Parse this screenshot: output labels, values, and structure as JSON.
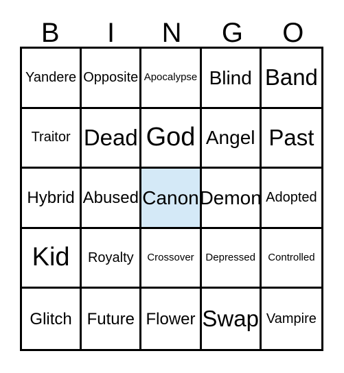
{
  "card": {
    "header": {
      "letters": [
        "B",
        "I",
        "N",
        "G",
        "O"
      ]
    },
    "marked_color": "#d4e9f7",
    "border_color": "#000000",
    "background_color": "#ffffff",
    "rows": [
      [
        {
          "label": "Yandere",
          "marked": false
        },
        {
          "label": "Opposite",
          "marked": false
        },
        {
          "label": "Apocalypse",
          "marked": false
        },
        {
          "label": "Blind",
          "marked": false
        },
        {
          "label": "Band",
          "marked": false
        }
      ],
      [
        {
          "label": "Traitor",
          "marked": false
        },
        {
          "label": "Dead",
          "marked": false
        },
        {
          "label": "God",
          "marked": false
        },
        {
          "label": "Angel",
          "marked": false
        },
        {
          "label": "Past",
          "marked": false
        }
      ],
      [
        {
          "label": "Hybrid",
          "marked": false
        },
        {
          "label": "Abused",
          "marked": false
        },
        {
          "label": "Canon",
          "marked": true
        },
        {
          "label": "Demon",
          "marked": false
        },
        {
          "label": "Adopted",
          "marked": false
        }
      ],
      [
        {
          "label": "Kid",
          "marked": false
        },
        {
          "label": "Royalty",
          "marked": false
        },
        {
          "label": "Crossover",
          "marked": false
        },
        {
          "label": "Depressed",
          "marked": false
        },
        {
          "label": "Controlled",
          "marked": false
        }
      ],
      [
        {
          "label": "Glitch",
          "marked": false
        },
        {
          "label": "Future",
          "marked": false
        },
        {
          "label": "Flower",
          "marked": false
        },
        {
          "label": "Swap",
          "marked": false
        },
        {
          "label": "Vampire",
          "marked": false
        }
      ]
    ]
  }
}
